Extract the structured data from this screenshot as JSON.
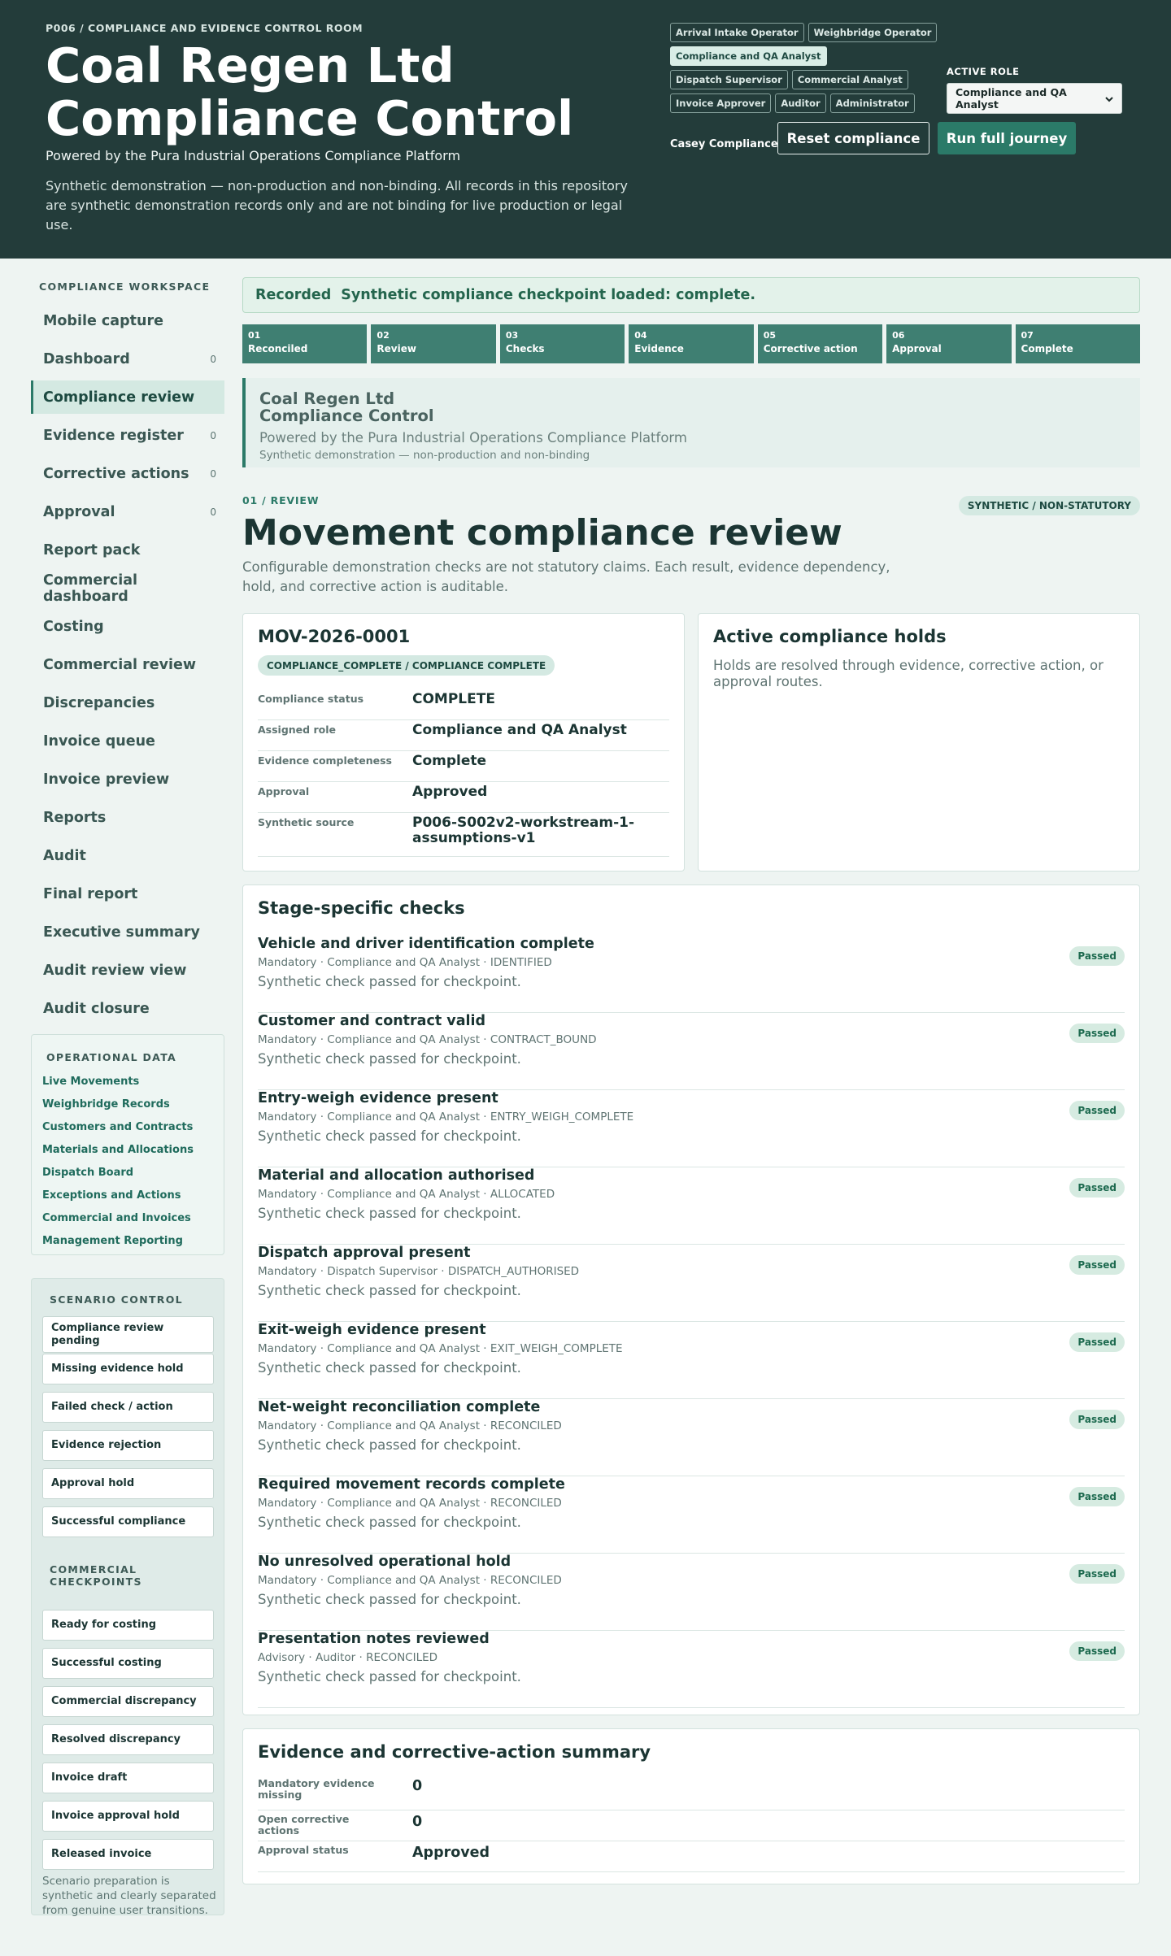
{
  "header": {
    "kicker": "P006 / COMPLIANCE AND EVIDENCE CONTROL ROOM",
    "title_line1": "Coal Regen Ltd",
    "title_line2": "Compliance Control",
    "powered": "Powered by the Pura Industrial Operations Compliance Platform",
    "disclaimer": "Synthetic demonstration — non-production and non-binding. All records in this repository are synthetic demonstration records only and are not binding for live production or legal use.",
    "roles": [
      "Arrival Intake Operator",
      "Weighbridge Operator",
      "Compliance and QA Analyst",
      "Dispatch Supervisor",
      "Commercial Analyst",
      "Invoice Approver",
      "Auditor",
      "Administrator"
    ],
    "active_role_index": 2,
    "active_role_label": "ACTIVE ROLE",
    "active_role_value": "Compliance and QA Analyst",
    "user_name": "Casey Compliance",
    "reset_label": "Reset compliance",
    "run_label": "Run full journey"
  },
  "sidebar": {
    "workspace_heading": "COMPLIANCE WORKSPACE",
    "items": [
      {
        "label": "Mobile capture",
        "count": ""
      },
      {
        "label": "Dashboard",
        "count": "0"
      },
      {
        "label": "Compliance review",
        "count": "",
        "active": true
      },
      {
        "label": "Evidence register",
        "count": "0"
      },
      {
        "label": "Corrective actions",
        "count": "0"
      },
      {
        "label": "Approval",
        "count": "0"
      },
      {
        "label": "Report pack",
        "count": ""
      },
      {
        "label": "Commercial dashboard",
        "count": ""
      },
      {
        "label": "Costing",
        "count": ""
      },
      {
        "label": "Commercial review",
        "count": ""
      },
      {
        "label": "Discrepancies",
        "count": ""
      },
      {
        "label": "Invoice queue",
        "count": ""
      },
      {
        "label": "Invoice preview",
        "count": ""
      },
      {
        "label": "Reports",
        "count": ""
      },
      {
        "label": "Audit",
        "count": ""
      },
      {
        "label": "Final report",
        "count": ""
      },
      {
        "label": "Executive summary",
        "count": ""
      },
      {
        "label": "Audit review view",
        "count": ""
      },
      {
        "label": "Audit closure",
        "count": ""
      }
    ],
    "operational_heading": "OPERATIONAL DATA",
    "operational_links": [
      "Live Movements",
      "Weighbridge Records",
      "Customers and Contracts",
      "Materials and Allocations",
      "Dispatch Board",
      "Exceptions and Actions",
      "Commercial and Invoices",
      "Management Reporting"
    ],
    "scenario_heading": "SCENARIO CONTROL",
    "scenario_buttons": [
      "Compliance review pending",
      "Missing evidence hold",
      "Failed check / action",
      "Evidence rejection",
      "Approval hold",
      "Successful compliance"
    ],
    "commercial_heading": "COMMERCIAL CHECKPOINTS",
    "commercial_buttons": [
      "Ready for costing",
      "Successful costing",
      "Commercial discrepancy",
      "Resolved discrepancy",
      "Invoice draft",
      "Invoice approval hold",
      "Released invoice"
    ],
    "scenario_note": "Scenario preparation is synthetic and clearly separated from genuine user transitions."
  },
  "main": {
    "banner_state": "Recorded",
    "banner_message": "Synthetic compliance checkpoint loaded: complete.",
    "steps": [
      {
        "num": "01",
        "label": "Reconciled"
      },
      {
        "num": "02",
        "label": "Review"
      },
      {
        "num": "03",
        "label": "Checks"
      },
      {
        "num": "04",
        "label": "Evidence"
      },
      {
        "num": "05",
        "label": "Corrective action"
      },
      {
        "num": "06",
        "label": "Approval"
      },
      {
        "num": "07",
        "label": "Complete"
      }
    ],
    "brand_line1": "Coal Regen Ltd",
    "brand_line2": "Compliance Control",
    "brand_powered": "Powered by the Pura Industrial Operations Compliance Platform",
    "brand_synthetic": "Synthetic demonstration — non-production and non-binding",
    "section_kicker": "01 / REVIEW",
    "synthetic_pill": "SYNTHETIC / NON-STATUTORY",
    "section_title": "Movement compliance review",
    "section_lead": "Configurable demonstration checks are not statutory claims. Each result, evidence dependency, hold, and corrective action is auditable.",
    "movement": {
      "id": "MOV-2026-0001",
      "badge": "COMPLIANCE_COMPLETE / COMPLIANCE COMPLETE",
      "fields": [
        {
          "k": "Compliance status",
          "v": "COMPLETE"
        },
        {
          "k": "Assigned role",
          "v": "Compliance and QA Analyst"
        },
        {
          "k": "Evidence completeness",
          "v": "Complete"
        },
        {
          "k": "Approval",
          "v": "Approved"
        },
        {
          "k": "Synthetic source",
          "v": "P006-S002v2-workstream-1-assumptions-v1"
        }
      ]
    },
    "holds": {
      "title": "Active compliance holds",
      "text": "Holds are resolved through evidence, corrective action, or approval routes."
    },
    "checks_title": "Stage-specific checks",
    "checks": [
      {
        "name": "Vehicle and driver identification complete",
        "meta": "Mandatory · Compliance and QA Analyst · IDENTIFIED",
        "desc": "Synthetic check passed for checkpoint.",
        "status": "Passed"
      },
      {
        "name": "Customer and contract valid",
        "meta": "Mandatory · Compliance and QA Analyst · CONTRACT_BOUND",
        "desc": "Synthetic check passed for checkpoint.",
        "status": "Passed"
      },
      {
        "name": "Entry-weigh evidence present",
        "meta": "Mandatory · Compliance and QA Analyst · ENTRY_WEIGH_COMPLETE",
        "desc": "Synthetic check passed for checkpoint.",
        "status": "Passed"
      },
      {
        "name": "Material and allocation authorised",
        "meta": "Mandatory · Compliance and QA Analyst · ALLOCATED",
        "desc": "Synthetic check passed for checkpoint.",
        "status": "Passed"
      },
      {
        "name": "Dispatch approval present",
        "meta": "Mandatory · Dispatch Supervisor · DISPATCH_AUTHORISED",
        "desc": "Synthetic check passed for checkpoint.",
        "status": "Passed"
      },
      {
        "name": "Exit-weigh evidence present",
        "meta": "Mandatory · Compliance and QA Analyst · EXIT_WEIGH_COMPLETE",
        "desc": "Synthetic check passed for checkpoint.",
        "status": "Passed"
      },
      {
        "name": "Net-weight reconciliation complete",
        "meta": "Mandatory · Compliance and QA Analyst · RECONCILED",
        "desc": "Synthetic check passed for checkpoint.",
        "status": "Passed"
      },
      {
        "name": "Required movement records complete",
        "meta": "Mandatory · Compliance and QA Analyst · RECONCILED",
        "desc": "Synthetic check passed for checkpoint.",
        "status": "Passed"
      },
      {
        "name": "No unresolved operational hold",
        "meta": "Mandatory · Compliance and QA Analyst · RECONCILED",
        "desc": "Synthetic check passed for checkpoint.",
        "status": "Passed"
      },
      {
        "name": "Presentation notes reviewed",
        "meta": "Advisory · Auditor · RECONCILED",
        "desc": "Synthetic check passed for checkpoint.",
        "status": "Passed"
      }
    ],
    "summary": {
      "title": "Evidence and corrective-action summary",
      "rows": [
        {
          "k": "Mandatory evidence missing",
          "v": "0"
        },
        {
          "k": "Open corrective actions",
          "v": "0"
        },
        {
          "k": "Approval status",
          "v": "Approved"
        }
      ]
    }
  },
  "colors": {
    "header_bg": "#233c3a",
    "accent": "#2b7a68",
    "step_bg": "#3f7f72",
    "page_bg": "#eef4f2"
  }
}
